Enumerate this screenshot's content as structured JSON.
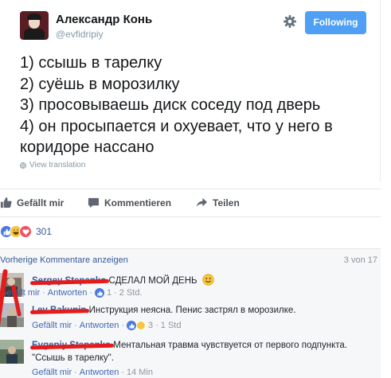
{
  "tweet": {
    "author_name": "Александр Конь",
    "author_handle": "@evfidripiy",
    "follow_label": "Following",
    "lines": [
      "1) ссышь в тарелку",
      "2) суёшь в морозилку",
      "3) просовываешь диск соседу под дверь",
      "4) он просыпается и охуевает, что у него в коридоре нассано"
    ],
    "view_translation": "View translation",
    "icons": {
      "settings": "gear-icon",
      "translate": "globe-icon"
    }
  },
  "actions": {
    "like_label": "Gefällt mir",
    "comment_label": "Kommentieren",
    "share_label": "Teilen"
  },
  "reactions": {
    "types": [
      "like",
      "haha",
      "love"
    ],
    "count": "301"
  },
  "comments": {
    "previous_label": "Vorherige Kommentare anzeigen",
    "count_label": "3 von 17",
    "items": [
      {
        "author": "Sergey Stepanko",
        "text": " СДЕЛАЛ МОЙ ДЕНЬ",
        "like": "Gefällt mir",
        "reply": "Antworten",
        "reactions": "1",
        "time": "2 Std."
      },
      {
        "author": "Lev Bakunin",
        "text": " Инструкция неясна. Пенис застрял в морозилке.",
        "like": "Gefällt mir",
        "reply": "Antworten",
        "reactions": "3",
        "time": "1 Std"
      },
      {
        "author": "Evgeniy Stepanko",
        "text": " Ментальная травма чувствуется от первого подпункта. \"Ссышь в тарелку\".",
        "like": "Gefällt mir",
        "reply": "Antworten",
        "time": "14 Min"
      }
    ]
  },
  "colors": {
    "twitter_blue": "#4f9ff5",
    "fb_link": "#365899",
    "redaction": "#e31b1b"
  }
}
